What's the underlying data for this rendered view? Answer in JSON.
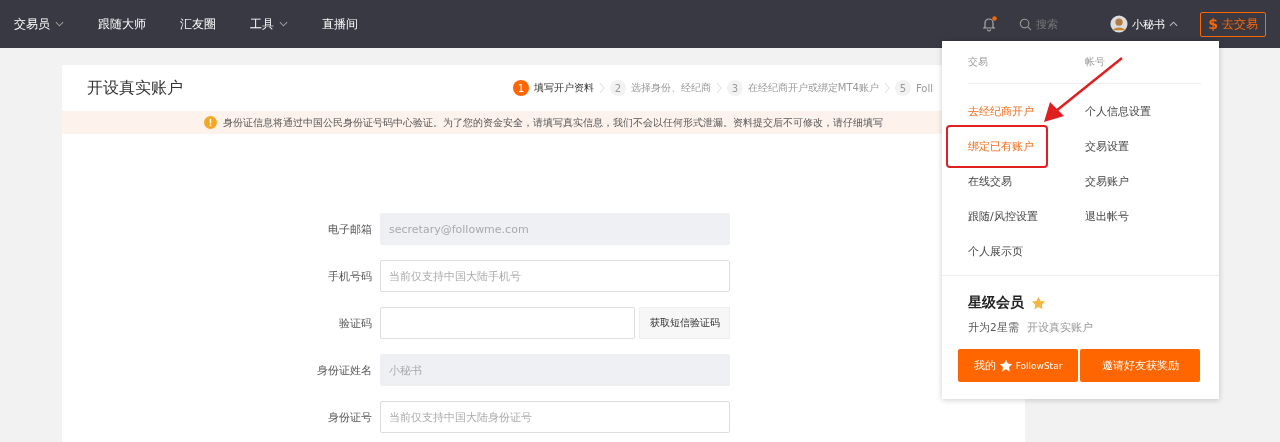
{
  "nav": {
    "items": [
      {
        "label": "交易员",
        "has_menu": true
      },
      {
        "label": "跟随大师",
        "has_menu": false
      },
      {
        "label": "汇友圈",
        "has_menu": false
      },
      {
        "label": "工具",
        "has_menu": true
      },
      {
        "label": "直播间",
        "has_menu": false
      }
    ],
    "notifications": {
      "unread": true
    },
    "search": {
      "placeholder": "搜索"
    },
    "user": {
      "name": "小秘书",
      "menu_open": true
    },
    "trade_button": {
      "icon_text": "$",
      "label": "去交易"
    }
  },
  "page": {
    "title": "开设真实账户",
    "steps": [
      {
        "number": "1",
        "label": "填写开户资料",
        "selected": true
      },
      {
        "number": "2",
        "label": "选择身份、经纪商",
        "selected": false
      },
      {
        "number": "3",
        "label": "在经纪商开户或绑定MT4账户",
        "selected": false
      },
      {
        "number": "5",
        "label": "Foll",
        "selected": false
      }
    ],
    "notice": "身份证信息将通过中国公民身份证号码中心验证。为了您的资金安全，请填写真实信息，我们不会以任何形式泄漏。资料提交后不可修改，请仔细填写",
    "form": [
      {
        "kind": "input",
        "label": "电子邮箱",
        "value": "secretary@followme.com",
        "disabled": true
      },
      {
        "kind": "input",
        "label": "手机号码",
        "placeholder": "当前仅支持中国大陆手机号",
        "disabled": false
      },
      {
        "kind": "code",
        "label": "验证码",
        "button": "获取短信验证码",
        "disabled": false
      },
      {
        "kind": "input",
        "label": "身份证姓名",
        "value": "小秘书",
        "disabled": true
      },
      {
        "kind": "input",
        "label": "身份证号",
        "placeholder": "当前仅支持中国大陆身份证号",
        "disabled": false
      }
    ]
  },
  "user_menu": {
    "columns": [
      {
        "heading": "交易",
        "items": [
          {
            "label": "去经纪商开户",
            "active": true,
            "highlighted": false
          },
          {
            "label": "绑定已有账户",
            "active": true,
            "highlighted": true
          },
          {
            "label": "在线交易",
            "active": false,
            "highlighted": false
          },
          {
            "label": "跟随/风控设置",
            "active": false,
            "highlighted": false
          },
          {
            "label": "个人展示页",
            "active": false,
            "highlighted": false
          }
        ]
      },
      {
        "heading": "帐号",
        "items": [
          {
            "label": "个人信息设置",
            "active": false,
            "highlighted": false
          },
          {
            "label": "交易设置",
            "active": false,
            "highlighted": false
          },
          {
            "label": "交易账户",
            "active": false,
            "highlighted": false
          },
          {
            "label": "退出帐号",
            "active": false,
            "highlighted": false
          }
        ]
      }
    ],
    "membership": {
      "title": "星级会员",
      "requirement": "升为2星需",
      "task": "开设真实账户"
    },
    "buttons": [
      {
        "kind": "brand",
        "label": "我的",
        "brand": "FollowStar"
      },
      {
        "kind": "plain",
        "label": "邀请好友获奖励"
      }
    ]
  }
}
